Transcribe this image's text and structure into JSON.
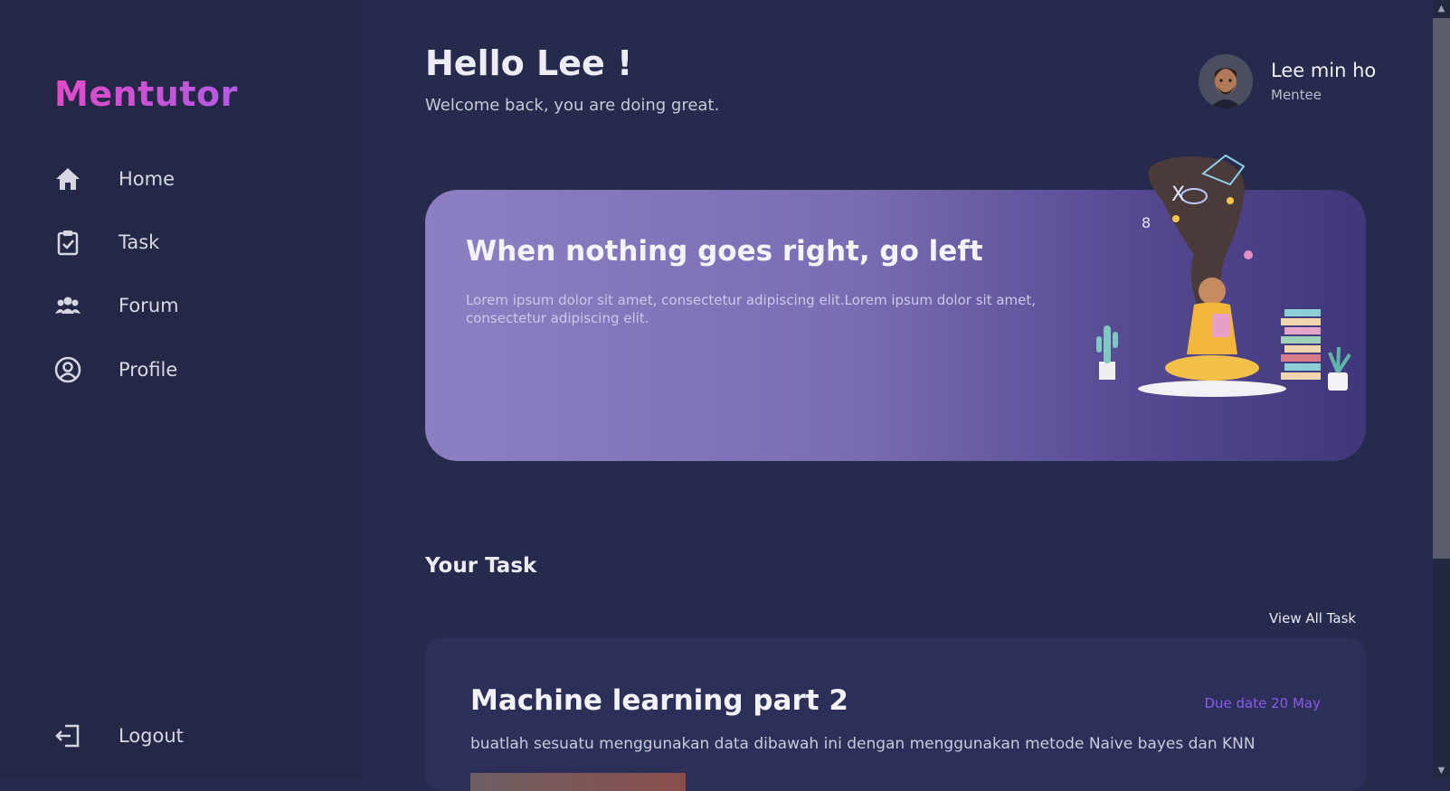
{
  "brand": "Mentutor",
  "sidebar": {
    "items": [
      {
        "label": "Home",
        "icon": "home-icon"
      },
      {
        "label": "Task",
        "icon": "clipboard-check-icon"
      },
      {
        "label": "Forum",
        "icon": "users-icon"
      },
      {
        "label": "Profile",
        "icon": "user-circle-icon"
      }
    ],
    "logout": {
      "label": "Logout",
      "icon": "logout-icon"
    }
  },
  "header": {
    "title": "Hello Lee !",
    "subtitle": "Welcome back, you are doing great."
  },
  "user": {
    "name": "Lee min ho",
    "role": "Mentee"
  },
  "banner": {
    "title": "When nothing goes right, go left",
    "text": "Lorem ipsum dolor sit amet, consectetur adipiscing elit.Lorem ipsum dolor sit amet, consectetur adipiscing elit."
  },
  "tasks": {
    "section_title": "Your Task",
    "view_all": "View All Task",
    "items": [
      {
        "title": "Machine learning part 2",
        "due": "Due date 20 May",
        "description": "buatlah sesuatu menggunakan data dibawah ini dengan menggunakan metode Naive bayes dan KNN"
      }
    ]
  },
  "colors": {
    "brand_gradient_start": "#e04bc8",
    "brand_gradient_end": "#b45ae6",
    "background": "#262a4d",
    "sidebar": "#242846",
    "banner_start": "#8d7fc3",
    "banner_end": "#3f3779",
    "card": "#2c3058",
    "due_accent": "#8b5ae8"
  }
}
